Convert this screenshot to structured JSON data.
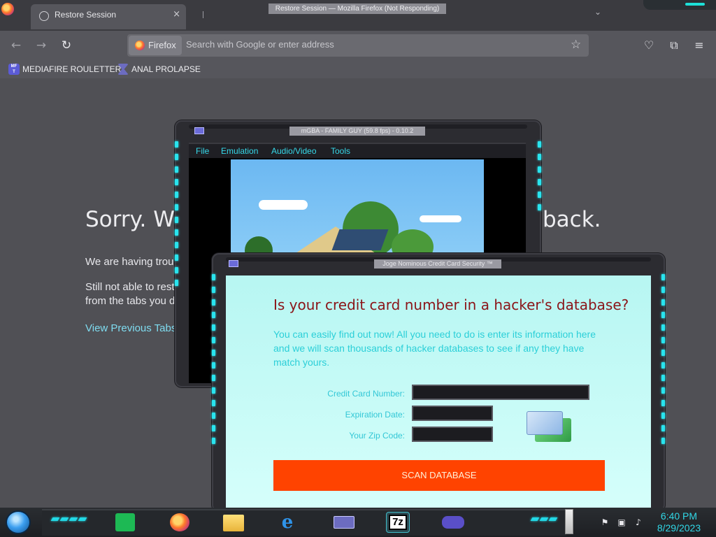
{
  "firefox": {
    "window_title": "Restore Session — Mozilla Firefox (Not Responding)",
    "tab_label": "Restore Session",
    "tab_close": "×",
    "new_tab_chevron": "⌄",
    "url_chip_label": "Firefox",
    "url_placeholder": "Search with Google or enter address",
    "bookmarks": [
      {
        "label": "MEDIAFIRE ROULETTER",
        "icon": "mediafire-icon",
        "icon_text": "MF\nT"
      },
      {
        "label": "ANAL PROLAPSE",
        "icon": "bookmark-icon"
      }
    ],
    "content": {
      "title_visible": "Sorry. We",
      "title_tail": "back.",
      "para1_visible": "We are having troub",
      "para2_line1": "Still not able to resto",
      "para2_line2": "from the tabs you do",
      "link_visible": "View Previous Tabs"
    }
  },
  "mgba": {
    "title": "mGBA - FAMILY GUY (59.8 fps) - 0.10.2",
    "menu": [
      "File",
      "Emulation",
      "Audio/Video",
      "Tools"
    ]
  },
  "cc_window": {
    "title": "Joge Nominous Credit Card Security ™",
    "heading": "Is your credit card number in a hacker's database?",
    "description": "You can easily find out now! All you need to do is enter its information here and we will scan thousands of hacker databases to see if any they have match yours.",
    "labels": {
      "card_number": "Credit Card Number:",
      "expiration": "Expiration Date:",
      "zip": "Your Zip Code:"
    },
    "fields": {
      "card_number": "",
      "expiration": "",
      "zip": ""
    },
    "scan_button": "SCAN DATABASE",
    "colors": {
      "button": "#ff4300",
      "heading": "#8b1418",
      "text": "#2bcfd8",
      "pane": "#c4fbf7"
    }
  },
  "taskbar": {
    "apps": [
      "spotify-icon",
      "firefox-icon",
      "file-explorer-icon",
      "internet-explorer-icon",
      "card-app-icon",
      "7zip-icon",
      "gameboy-advance-icon"
    ],
    "sevenzip_label": "7z",
    "clock_time": "6:40 PM",
    "clock_date": "8/29/2023",
    "accent": "#22d9e6"
  }
}
